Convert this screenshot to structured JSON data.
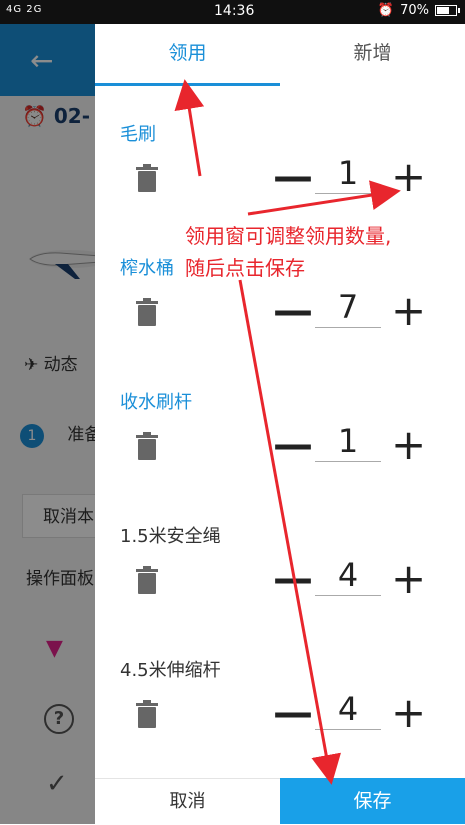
{
  "status_bar": {
    "signal": "4G 2G",
    "time": "14:36",
    "alarm_icon": "alarm-icon",
    "battery": "70%",
    "battery_level": 0.7
  },
  "background": {
    "date_text": "02-",
    "dynamic_label": "动态",
    "step_number": "1",
    "step_text": "准备",
    "cancel_button": "取消本",
    "panel_label": "操作面板"
  },
  "dialog": {
    "tabs": [
      {
        "label": "领用",
        "active": true
      },
      {
        "label": "新增",
        "active": false
      }
    ],
    "items": [
      {
        "name": "毛刷",
        "quantity": "1",
        "highlight": true
      },
      {
        "name": "榨水桶",
        "quantity": "7",
        "highlight": true
      },
      {
        "name": "收水刷杆",
        "quantity": "1",
        "highlight": true
      },
      {
        "name": "1.5米安全绳",
        "quantity": "4",
        "highlight": false
      },
      {
        "name": "4.5米伸缩杆",
        "quantity": "4",
        "highlight": false
      }
    ],
    "minus_symbol": "—",
    "plus_symbol": "+",
    "cancel_label": "取消",
    "save_label": "保存"
  },
  "annotation": {
    "line1": "领用窗可调整领用数量,",
    "line2": "随后点击保存",
    "color": "#e8262d"
  },
  "colors": {
    "accent": "#1a8fd8",
    "save_button": "#19a0e8"
  }
}
